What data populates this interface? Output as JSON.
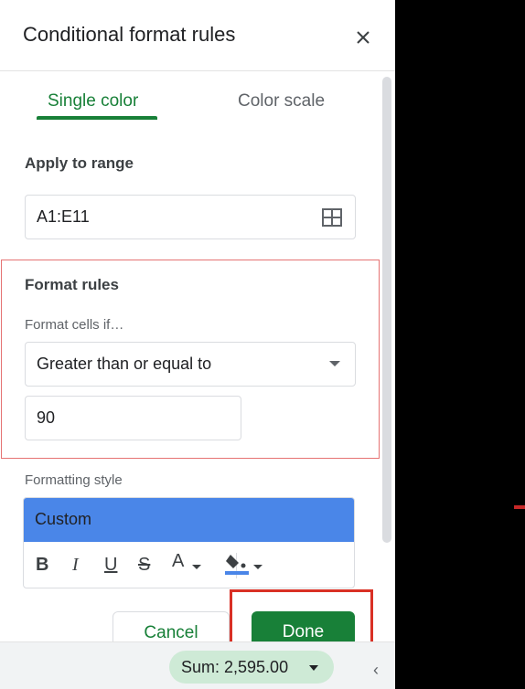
{
  "header": {
    "title": "Conditional format rules"
  },
  "tabs": [
    {
      "label": "Single color",
      "active": true
    },
    {
      "label": "Color scale",
      "active": false
    }
  ],
  "apply_range": {
    "label": "Apply to range",
    "value": "A1:E11"
  },
  "format_rules": {
    "title": "Format rules",
    "condition_label": "Format cells if…",
    "condition_value": "Greater than or equal to",
    "value": "90"
  },
  "formatting_style": {
    "label": "Formatting style",
    "preset": "Custom",
    "preset_color": "#4a86e8",
    "toolbar": {
      "bold": "B",
      "italic": "I",
      "underline": "U",
      "strike": "S",
      "text_color": "A"
    }
  },
  "actions": {
    "cancel": "Cancel",
    "done": "Done"
  },
  "status": {
    "sum": "Sum: 2,595.00"
  },
  "colors": {
    "accent": "#188038",
    "highlight": "#d93025"
  }
}
